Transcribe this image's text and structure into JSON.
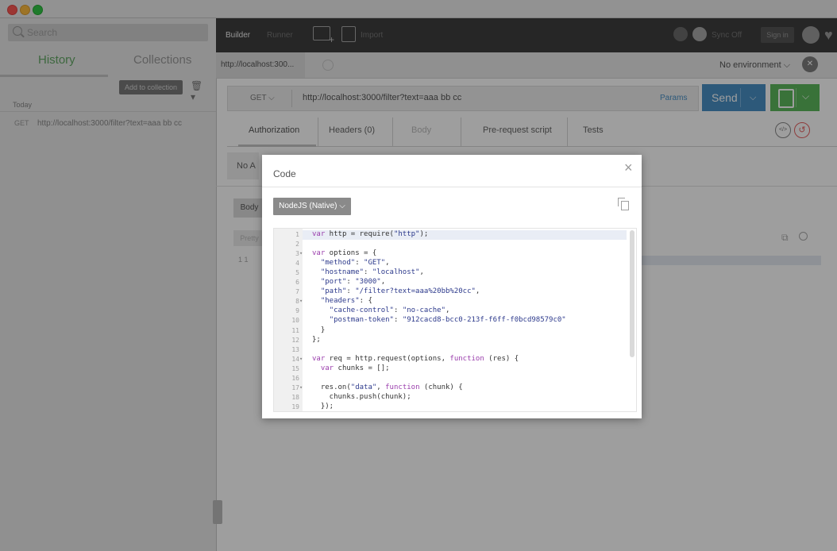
{
  "sidebar": {
    "search_placeholder": "Search",
    "tabs": [
      "History",
      "Collections"
    ],
    "add_to_collection": "Add to collection",
    "section_label": "Today",
    "history_items": [
      {
        "method": "GET",
        "url": "http://localhost:3000/filter?text=aaa bb cc"
      }
    ]
  },
  "topbar": {
    "builder": "Builder",
    "runner": "Runner",
    "import": "Import",
    "sync": "Sync Off",
    "signin": "Sign in"
  },
  "tabstrip": {
    "request_tab": "http://localhost:300...",
    "environment": "No environment ⌵"
  },
  "request": {
    "method": "GET ⌵",
    "url": "http://localhost:3000/filter?text=aaa bb cc",
    "params": "Params",
    "send": "Send",
    "send_chevron": "⌵",
    "save_chevron": "⌵"
  },
  "subtabs": [
    "Authorization",
    "Headers (0)",
    "Body",
    "Pre-request script",
    "Tests"
  ],
  "auth_panel_text": "No A",
  "response": {
    "body_tab": "Body",
    "pretty": "Pretty",
    "line_num": "1 1"
  },
  "modal": {
    "title": "Code",
    "close": "×",
    "language": "NodeJS (Native) ⌵",
    "code_lines": [
      {
        "n": "1",
        "fold": "",
        "text": "var http = require(\"http\");"
      },
      {
        "n": "2",
        "fold": "",
        "text": ""
      },
      {
        "n": "3",
        "fold": "▾",
        "text": "var options = {"
      },
      {
        "n": "4",
        "fold": "",
        "text": "  \"method\": \"GET\","
      },
      {
        "n": "5",
        "fold": "",
        "text": "  \"hostname\": \"localhost\","
      },
      {
        "n": "6",
        "fold": "",
        "text": "  \"port\": \"3000\","
      },
      {
        "n": "7",
        "fold": "",
        "text": "  \"path\": \"/filter?text=aaa%20bb%20cc\","
      },
      {
        "n": "8",
        "fold": "▾",
        "text": "  \"headers\": {"
      },
      {
        "n": "9",
        "fold": "",
        "text": "    \"cache-control\": \"no-cache\","
      },
      {
        "n": "10",
        "fold": "",
        "text": "    \"postman-token\": \"912cacd8-bcc0-213f-f6ff-f0bcd98579c0\""
      },
      {
        "n": "11",
        "fold": "",
        "text": "  }"
      },
      {
        "n": "12",
        "fold": "",
        "text": "};"
      },
      {
        "n": "13",
        "fold": "",
        "text": ""
      },
      {
        "n": "14",
        "fold": "▾",
        "text": "var req = http.request(options, function (res) {"
      },
      {
        "n": "15",
        "fold": "",
        "text": "  var chunks = [];"
      },
      {
        "n": "16",
        "fold": "",
        "text": ""
      },
      {
        "n": "17",
        "fold": "▾",
        "text": "  res.on(\"data\", function (chunk) {"
      },
      {
        "n": "18",
        "fold": "",
        "text": "    chunks.push(chunk);"
      },
      {
        "n": "19",
        "fold": "",
        "text": "  });"
      }
    ]
  }
}
